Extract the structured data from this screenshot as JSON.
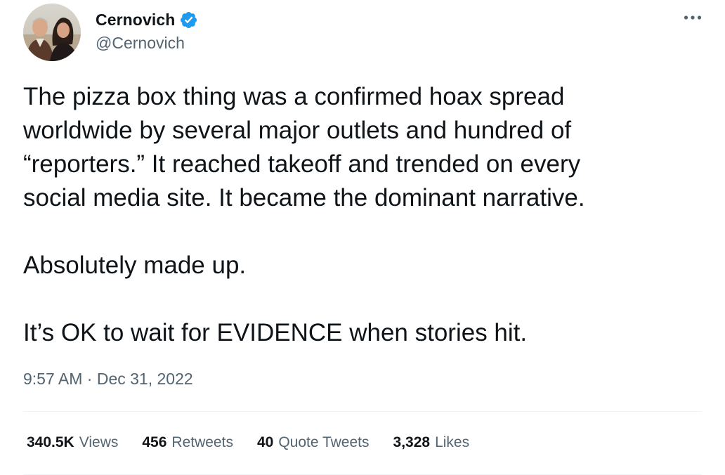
{
  "user": {
    "display_name": "Cernovich",
    "handle": "@Cernovich",
    "verified": true,
    "verified_color": "#1d9bf0"
  },
  "tweet": {
    "lines": [
      "The pizza box thing was a confirmed hoax spread",
      "worldwide by several major outlets and hundred of",
      "“reporters.” It reached takeoff and trended on every",
      "social media site. It became the dominant narrative."
    ],
    "paragraph2": "Absolutely made up.",
    "paragraph3": "It’s OK to wait for EVIDENCE when stories hit."
  },
  "meta": {
    "time": "9:57 AM",
    "separator": " · ",
    "date": "Dec 31, 2022"
  },
  "stats": {
    "views_count": "340.5K",
    "views_label": "Views",
    "retweets_count": "456",
    "retweets_label": "Retweets",
    "quotes_count": "40",
    "quotes_label": "Quote Tweets",
    "likes_count": "3,328",
    "likes_label": "Likes"
  },
  "icons": {
    "verified": "verified-badge-icon",
    "more": "more-options-icon"
  }
}
